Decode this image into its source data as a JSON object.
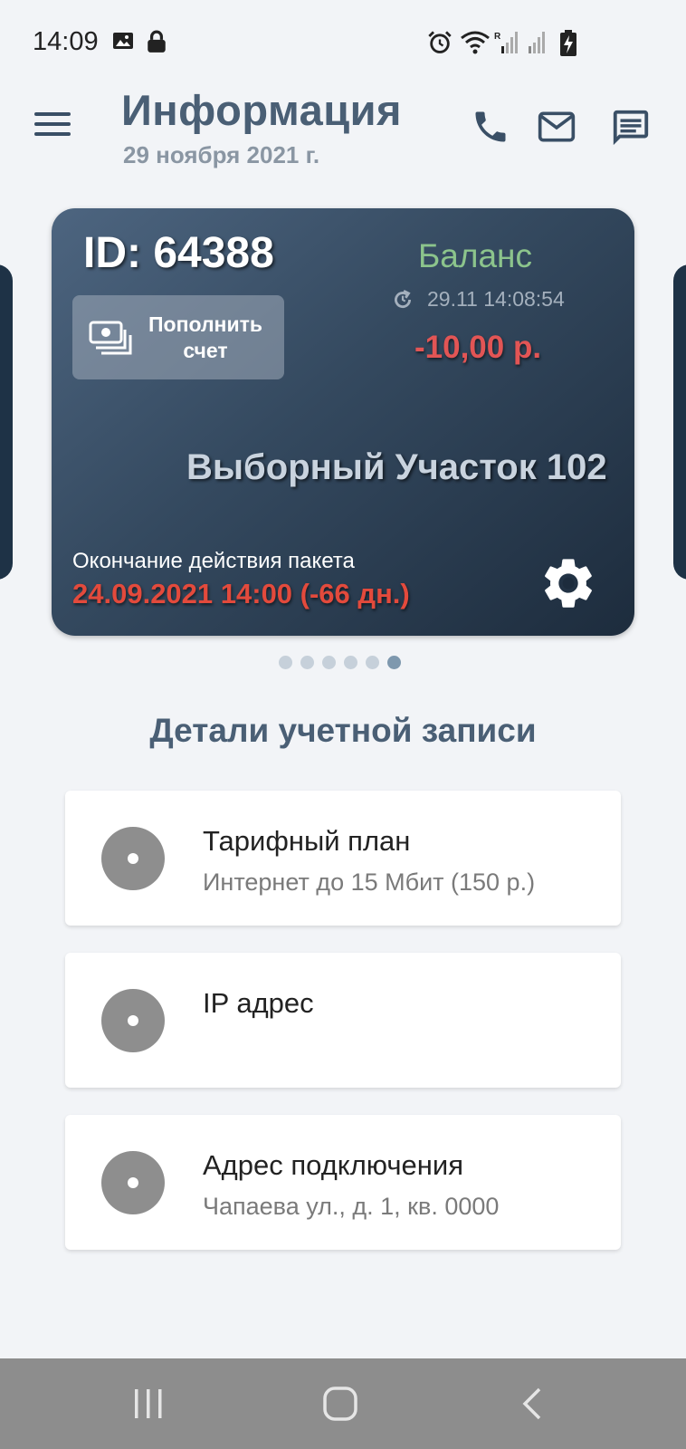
{
  "status_bar": {
    "time": "14:09"
  },
  "header": {
    "title": "Информация",
    "date": "29 ноября 2021 г."
  },
  "account_card": {
    "id": "ID: 64388",
    "topup_label": "Пополнить счет",
    "balance_title": "Баланс",
    "balance_updated": "29.11 14:08:54",
    "balance_value": "-10,00 р.",
    "place_name": "Выборный Участок 102",
    "expire_label": "Окончание действия пакета",
    "expire_value": "24.09.2021 14:00 (-66 дн.)"
  },
  "pager": {
    "count": 6,
    "active_index": 5
  },
  "details": {
    "title": "Детали учетной записи",
    "items": [
      {
        "title": "Тарифный план",
        "subtitle": "Интернет до 15 Мбит (150 р.)"
      },
      {
        "title": "IP адрес",
        "subtitle": ""
      },
      {
        "title": "Адрес подключения",
        "subtitle": "Чапаева ул., д. 1, кв. 0000"
      }
    ]
  },
  "colors": {
    "background": "#f2f4f7",
    "card_dark": "#2b3d52",
    "balance_green": "#8cc48c",
    "negative_red": "#e25555",
    "title_slate": "#4a5f75"
  },
  "icons": [
    "image-icon",
    "lock-icon",
    "alarm-icon",
    "wifi-icon",
    "signal-icon",
    "battery-charging-icon",
    "menu-icon",
    "phone-icon",
    "mail-icon",
    "message-icon",
    "money-icon",
    "refresh-icon",
    "gear-icon",
    "disc-icon",
    "recent-apps-icon",
    "home-icon",
    "back-icon"
  ]
}
